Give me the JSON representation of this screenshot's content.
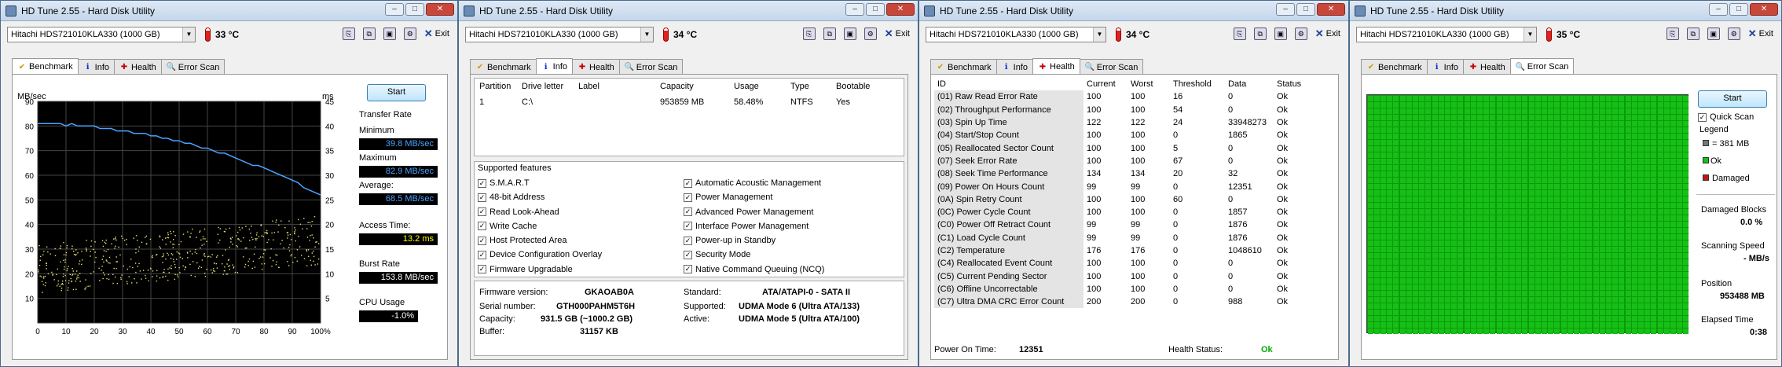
{
  "app_title": "HD Tune 2.55 - Hard Disk Utility",
  "drive": "Hitachi HDS721010KLA330 (1000 GB)",
  "exit_label": "Exit",
  "tab_labels": [
    "Benchmark",
    "Info",
    "Health",
    "Error Scan"
  ],
  "windows": [
    {
      "temp": "33 °C"
    },
    {
      "temp": "34 °C"
    },
    {
      "temp": "34 °C"
    },
    {
      "temp": "35 °C"
    }
  ],
  "benchmark": {
    "start_label": "Start",
    "y_left_unit": "MB/sec",
    "y_right_unit": "ms",
    "y_left_ticks": [
      "90",
      "80",
      "70",
      "60",
      "50",
      "40",
      "30",
      "20",
      "10"
    ],
    "y_right_ticks": [
      "45",
      "40",
      "35",
      "30",
      "25",
      "20",
      "15",
      "10",
      "5"
    ],
    "x_ticks": [
      "0",
      "10",
      "20",
      "30",
      "40",
      "50",
      "60",
      "70",
      "80",
      "90",
      "100%"
    ],
    "transfer_rate_label": "Transfer Rate",
    "minimum_label": "Minimum",
    "minimum": "39.8 MB/sec",
    "maximum_label": "Maximum",
    "maximum": "82.9 MB/sec",
    "average_label": "Average:",
    "average": "68.5 MB/sec",
    "access_label": "Access Time:",
    "access": "13.2 ms",
    "burst_label": "Burst Rate",
    "burst": "153.8 MB/sec",
    "cpu_label": "CPU Usage",
    "cpu": "-1.0%",
    "colors": {
      "transfer": "#4aa3ff",
      "access": "#e8e070",
      "minimum": "#4aa3ff",
      "access_text": "#ffff00",
      "burst": "#ffffff",
      "cpu": "#ffffff"
    }
  },
  "chart_data": {
    "type": "line",
    "x": [
      0,
      2,
      4,
      6,
      8,
      10,
      12,
      14,
      16,
      18,
      20,
      22,
      24,
      26,
      28,
      30,
      32,
      34,
      36,
      38,
      40,
      42,
      44,
      46,
      48,
      50,
      52,
      54,
      56,
      58,
      60,
      62,
      64,
      66,
      68,
      70,
      72,
      74,
      76,
      78,
      80,
      82,
      84,
      86,
      88,
      90,
      92,
      94,
      96,
      98,
      100
    ],
    "series": [
      {
        "values": [
          81,
          81,
          81,
          81,
          81,
          80,
          81,
          80,
          80,
          80,
          80,
          79,
          79,
          79,
          78,
          78,
          78,
          77,
          77,
          77,
          76,
          76,
          75,
          75,
          74,
          74,
          73,
          73,
          72,
          71,
          71,
          70,
          69,
          69,
          68,
          67,
          66,
          65,
          64,
          64,
          63,
          62,
          61,
          60,
          59,
          58,
          57,
          55,
          54,
          53,
          52
        ]
      }
    ],
    "xlabel": "",
    "ylabel": "MB/sec",
    "xlim": [
      0,
      100
    ],
    "ylim": [
      0,
      90
    ],
    "y2lim": [
      0,
      45
    ]
  },
  "info": {
    "columns": [
      "Partition",
      "Drive letter",
      "Label",
      "Capacity",
      "Usage",
      "Type",
      "Bootable"
    ],
    "rows": [
      [
        "1",
        "C:\\",
        "",
        "953859 MB",
        "58.48%",
        "NTFS",
        "Yes"
      ]
    ],
    "features_title": "Supported features",
    "features_left": [
      "S.M.A.R.T",
      "48-bit Address",
      "Read Look-Ahead",
      "Write Cache",
      "Host Protected Area",
      "Device Configuration Overlay",
      "Firmware Upgradable"
    ],
    "features_right": [
      "Automatic Acoustic Management",
      "Power Management",
      "Advanced Power Management",
      "Interface Power Management",
      "Power-up in Standby",
      "Security Mode",
      "Native Command Queuing (NCQ)"
    ],
    "firmware_label": "Firmware version:",
    "firmware": "GKAOAB0A",
    "serial_label": "Serial number:",
    "serial": "GTH000PAHM5T6H",
    "capacity_label": "Capacity:",
    "capacity": "931.5 GB (~1000.2 GB)",
    "buffer_label": "Buffer:",
    "buffer": "31157 KB",
    "standard_label": "Standard:",
    "standard": "ATA/ATAPI-0 - SATA II",
    "supported_label": "Supported:",
    "supported": "UDMA Mode 6 (Ultra ATA/133)",
    "active_label": "Active:",
    "active": "UDMA Mode 5 (Ultra ATA/100)"
  },
  "health": {
    "columns": [
      "ID",
      "Current",
      "Worst",
      "Threshold",
      "Data",
      "Status"
    ],
    "rows": [
      [
        "(01) Raw Read Error Rate",
        "100",
        "100",
        "16",
        "0",
        "Ok"
      ],
      [
        "(02) Throughput Performance",
        "100",
        "100",
        "54",
        "0",
        "Ok"
      ],
      [
        "(03) Spin Up Time",
        "122",
        "122",
        "24",
        "33948273",
        "Ok"
      ],
      [
        "(04) Start/Stop Count",
        "100",
        "100",
        "0",
        "1865",
        "Ok"
      ],
      [
        "(05) Reallocated Sector Count",
        "100",
        "100",
        "5",
        "0",
        "Ok"
      ],
      [
        "(07) Seek Error Rate",
        "100",
        "100",
        "67",
        "0",
        "Ok"
      ],
      [
        "(08) Seek Time Performance",
        "134",
        "134",
        "20",
        "32",
        "Ok"
      ],
      [
        "(09) Power On Hours Count",
        "99",
        "99",
        "0",
        "12351",
        "Ok"
      ],
      [
        "(0A) Spin Retry Count",
        "100",
        "100",
        "60",
        "0",
        "Ok"
      ],
      [
        "(0C) Power Cycle Count",
        "100",
        "100",
        "0",
        "1857",
        "Ok"
      ],
      [
        "(C0) Power Off Retract Count",
        "99",
        "99",
        "0",
        "1876",
        "Ok"
      ],
      [
        "(C1) Load Cycle Count",
        "99",
        "99",
        "0",
        "1876",
        "Ok"
      ],
      [
        "(C2) Temperature",
        "176",
        "176",
        "0",
        "1048610",
        "Ok"
      ],
      [
        "(C4) Reallocated Event Count",
        "100",
        "100",
        "0",
        "0",
        "Ok"
      ],
      [
        "(C5) Current Pending Sector",
        "100",
        "100",
        "0",
        "0",
        "Ok"
      ],
      [
        "(C6) Offline Uncorrectable",
        "100",
        "100",
        "0",
        "0",
        "Ok"
      ],
      [
        "(C7) Ultra DMA CRC Error Count",
        "200",
        "200",
        "0",
        "988",
        "Ok"
      ]
    ],
    "power_on_label": "Power On Time:",
    "power_on": "12351",
    "health_status_label": "Health Status:",
    "health_status": "Ok",
    "ok_color": "#00aa00"
  },
  "errorscan": {
    "start_label": "Start",
    "quick_scan_label": "Quick Scan",
    "legend_title": "Legend",
    "legend_block": "= 381 MB",
    "legend_ok": "Ok",
    "legend_damaged": "Damaged",
    "damaged_blocks_label": "Damaged Blocks",
    "damaged_blocks": "0.0 %",
    "scanning_speed_label": "Scanning Speed",
    "scanning_speed": "- MB/s",
    "position_label": "Position",
    "position": "953488 MB",
    "elapsed_label": "Elapsed Time",
    "elapsed": "0:38",
    "colors": {
      "ok": "#16c016",
      "damaged": "#c01616",
      "block": "#777777"
    }
  }
}
